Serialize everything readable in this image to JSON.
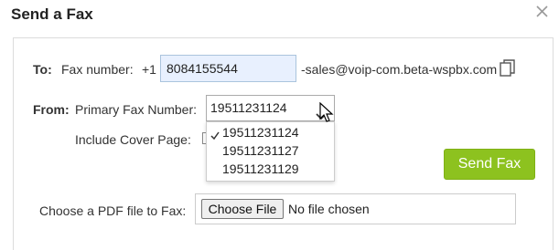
{
  "dialog": {
    "title": "Send a Fax"
  },
  "to": {
    "label": "To:",
    "fax_label": "Fax number:",
    "country_code": "+1",
    "fax_value": "8084155544",
    "suffix": "-sales@voip-com.beta-wspbx.com"
  },
  "from": {
    "label": "From:",
    "primary_label": "Primary Fax Number:",
    "selected": "19511231124",
    "options": [
      "19511231124",
      "19511231127",
      "19511231129"
    ]
  },
  "cover_page": {
    "label": "Include Cover Page:"
  },
  "send_button": {
    "label": "Send Fax"
  },
  "file": {
    "label": "Choose a PDF file to Fax:",
    "button_label": "Choose File",
    "status": "No file chosen"
  },
  "colors": {
    "send_button": "#8dc21f",
    "fax_input_bg": "#e8f0fe"
  },
  "icons": {
    "close": "close-icon",
    "copy": "copy-icon",
    "chevron": "chevron-down-icon",
    "check": "checkmark-icon",
    "cursor": "mouse-cursor-icon"
  }
}
